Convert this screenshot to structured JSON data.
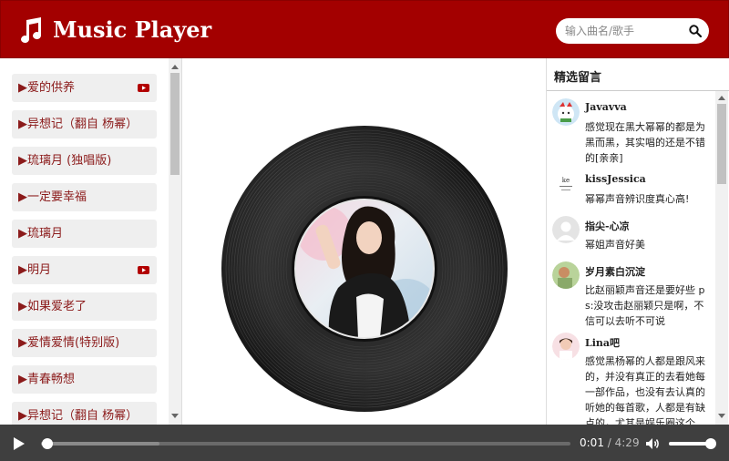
{
  "header": {
    "title": "Music Player",
    "logo_icon": "music-note-icon",
    "search_placeholder": "输入曲名/歌手",
    "search_icon": "search-icon"
  },
  "playlist": {
    "items": [
      {
        "label": "▶爱的供养",
        "video": true
      },
      {
        "label": "▶异想记（翻自 杨幂）",
        "video": false
      },
      {
        "label": "▶琉璃月 (独唱版)",
        "video": false
      },
      {
        "label": "▶一定要幸福",
        "video": false
      },
      {
        "label": "▶琉璃月",
        "video": false
      },
      {
        "label": "▶明月",
        "video": true
      },
      {
        "label": "▶如果爱老了",
        "video": false
      },
      {
        "label": "▶爱情爱情(特别版)",
        "video": false
      },
      {
        "label": "▶青春畅想",
        "video": false
      },
      {
        "label": "▶异想记（翻自 杨幂）",
        "video": false
      }
    ]
  },
  "comments": {
    "title": "精选留言",
    "items": [
      {
        "user": "Javavva",
        "text": "感觉现在黑大幂幂的都是为黑而黑，其实唱的还是不错的[亲亲]"
      },
      {
        "user": "kissJessica",
        "text": "幂幂声音辨识度真心高!"
      },
      {
        "user": "指尖-心凉",
        "text": "幂姐声音好美"
      },
      {
        "user": "岁月素白沉淀",
        "text": "比赵丽颖声音还是要好些 ps:没攻击赵丽颖只是啊，不信可以去听不可说"
      },
      {
        "user": "Lina吧",
        "text": "感觉黑杨幂的人都是跟风来的，并没有真正的去看她每一部作品，也没有去认真的听她的每首歌，人都是有缺点的，尤其是娱乐圈这个..."
      }
    ]
  },
  "player": {
    "play_icon": "play-icon",
    "volume_icon": "volume-icon",
    "current_time": "0:01",
    "separator": " / ",
    "duration": "4:29",
    "progress_fraction": 0.004,
    "volume_fraction": 1.0
  },
  "colors": {
    "header_bg": "#a30000",
    "player_bg": "#3f3f3f",
    "playlist_text": "#8b1a1a",
    "video_icon": "#b20000"
  }
}
